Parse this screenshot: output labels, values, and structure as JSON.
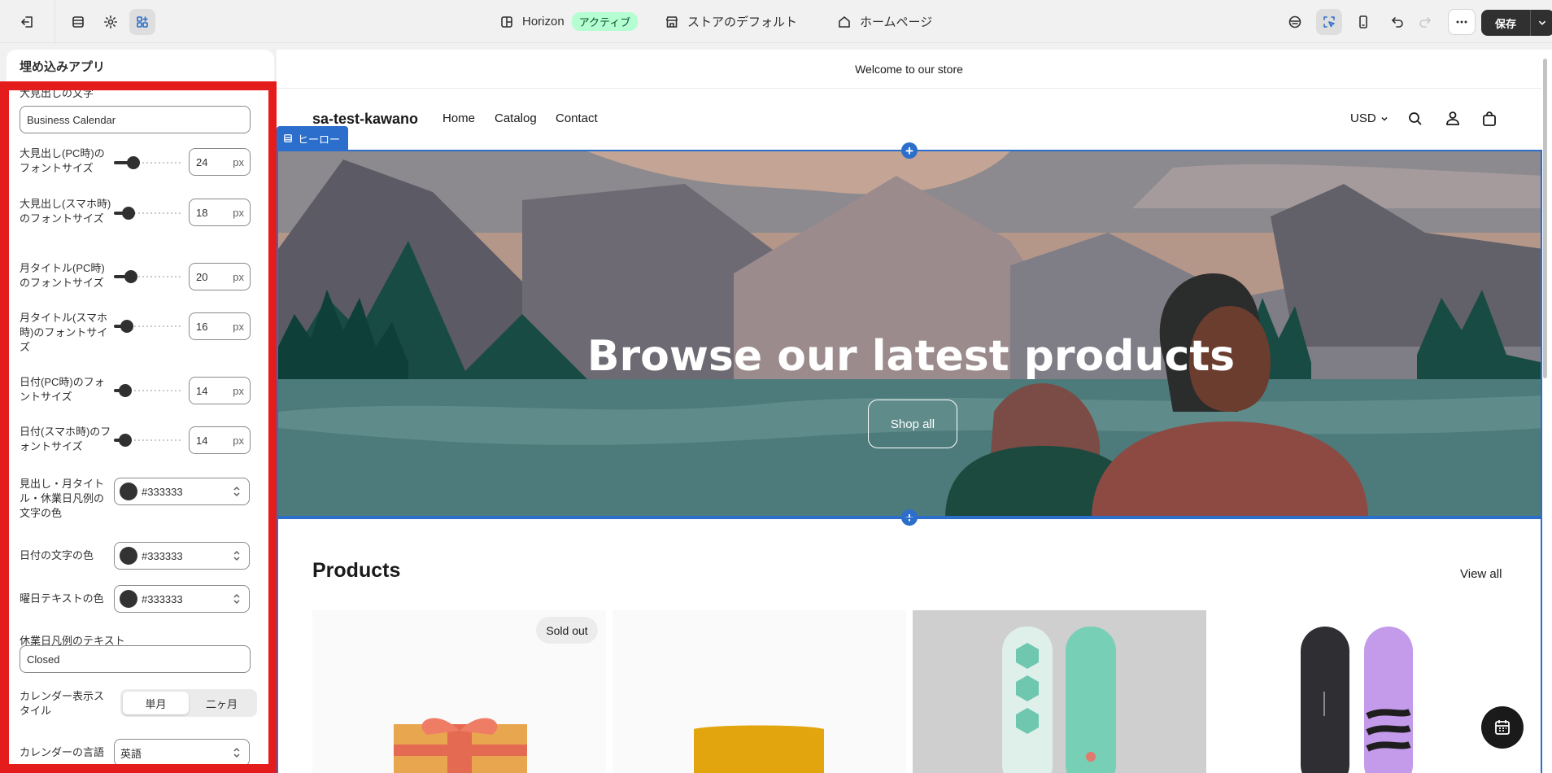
{
  "topbar": {
    "theme_name": "Horizon",
    "theme_status": "アクティブ",
    "store_default": "ストアのデフォルト",
    "homepage": "ホームページ",
    "save_label": "保存"
  },
  "sidebar": {
    "title": "埋め込みアプリ",
    "heading_text_label": "大見出しの文字",
    "heading_text_value": "Business Calendar",
    "sliders": [
      {
        "label": "大見出し(PC時)のフォントサイズ",
        "value": "24",
        "unit": "px"
      },
      {
        "label": "大見出し(スマホ時)のフォントサイズ",
        "value": "18",
        "unit": "px"
      },
      {
        "label": "月タイトル(PC時)のフォントサイズ",
        "value": "20",
        "unit": "px"
      },
      {
        "label": "月タイトル(スマホ時)のフォントサイズ",
        "value": "16",
        "unit": "px"
      },
      {
        "label": "日付(PC時)のフォントサイズ",
        "value": "14",
        "unit": "px"
      },
      {
        "label": "日付(スマホ時)のフォントサイズ",
        "value": "14",
        "unit": "px"
      }
    ],
    "colors": [
      {
        "label": "見出し・月タイトル・休業日凡例の文字の色",
        "value": "#333333"
      },
      {
        "label": "日付の文字の色",
        "value": "#333333"
      },
      {
        "label": "曜日テキストの色",
        "value": "#333333"
      }
    ],
    "closed_legend_label": "休業日凡例のテキスト",
    "closed_legend_value": "Closed",
    "display_style_label": "カレンダー表示スタイル",
    "display_style_options": [
      "単月",
      "二ヶ月"
    ],
    "language_label": "カレンダーの言語",
    "language_value": "英語"
  },
  "preview": {
    "announcement": "Welcome to our store",
    "store_name": "sa-test-kawano",
    "nav": [
      "Home",
      "Catalog",
      "Contact"
    ],
    "currency": "USD",
    "hero_tag": "ヒーロー",
    "hero_title": "Browse our latest products",
    "hero_button": "Shop all",
    "products_title": "Products",
    "view_all": "View all",
    "sold_out": "Sold out"
  },
  "colors": {
    "accent": "#2c6ecb",
    "highlight": "#e51c1c",
    "badge_bg": "#b4fed2",
    "swatch": "#333333"
  }
}
